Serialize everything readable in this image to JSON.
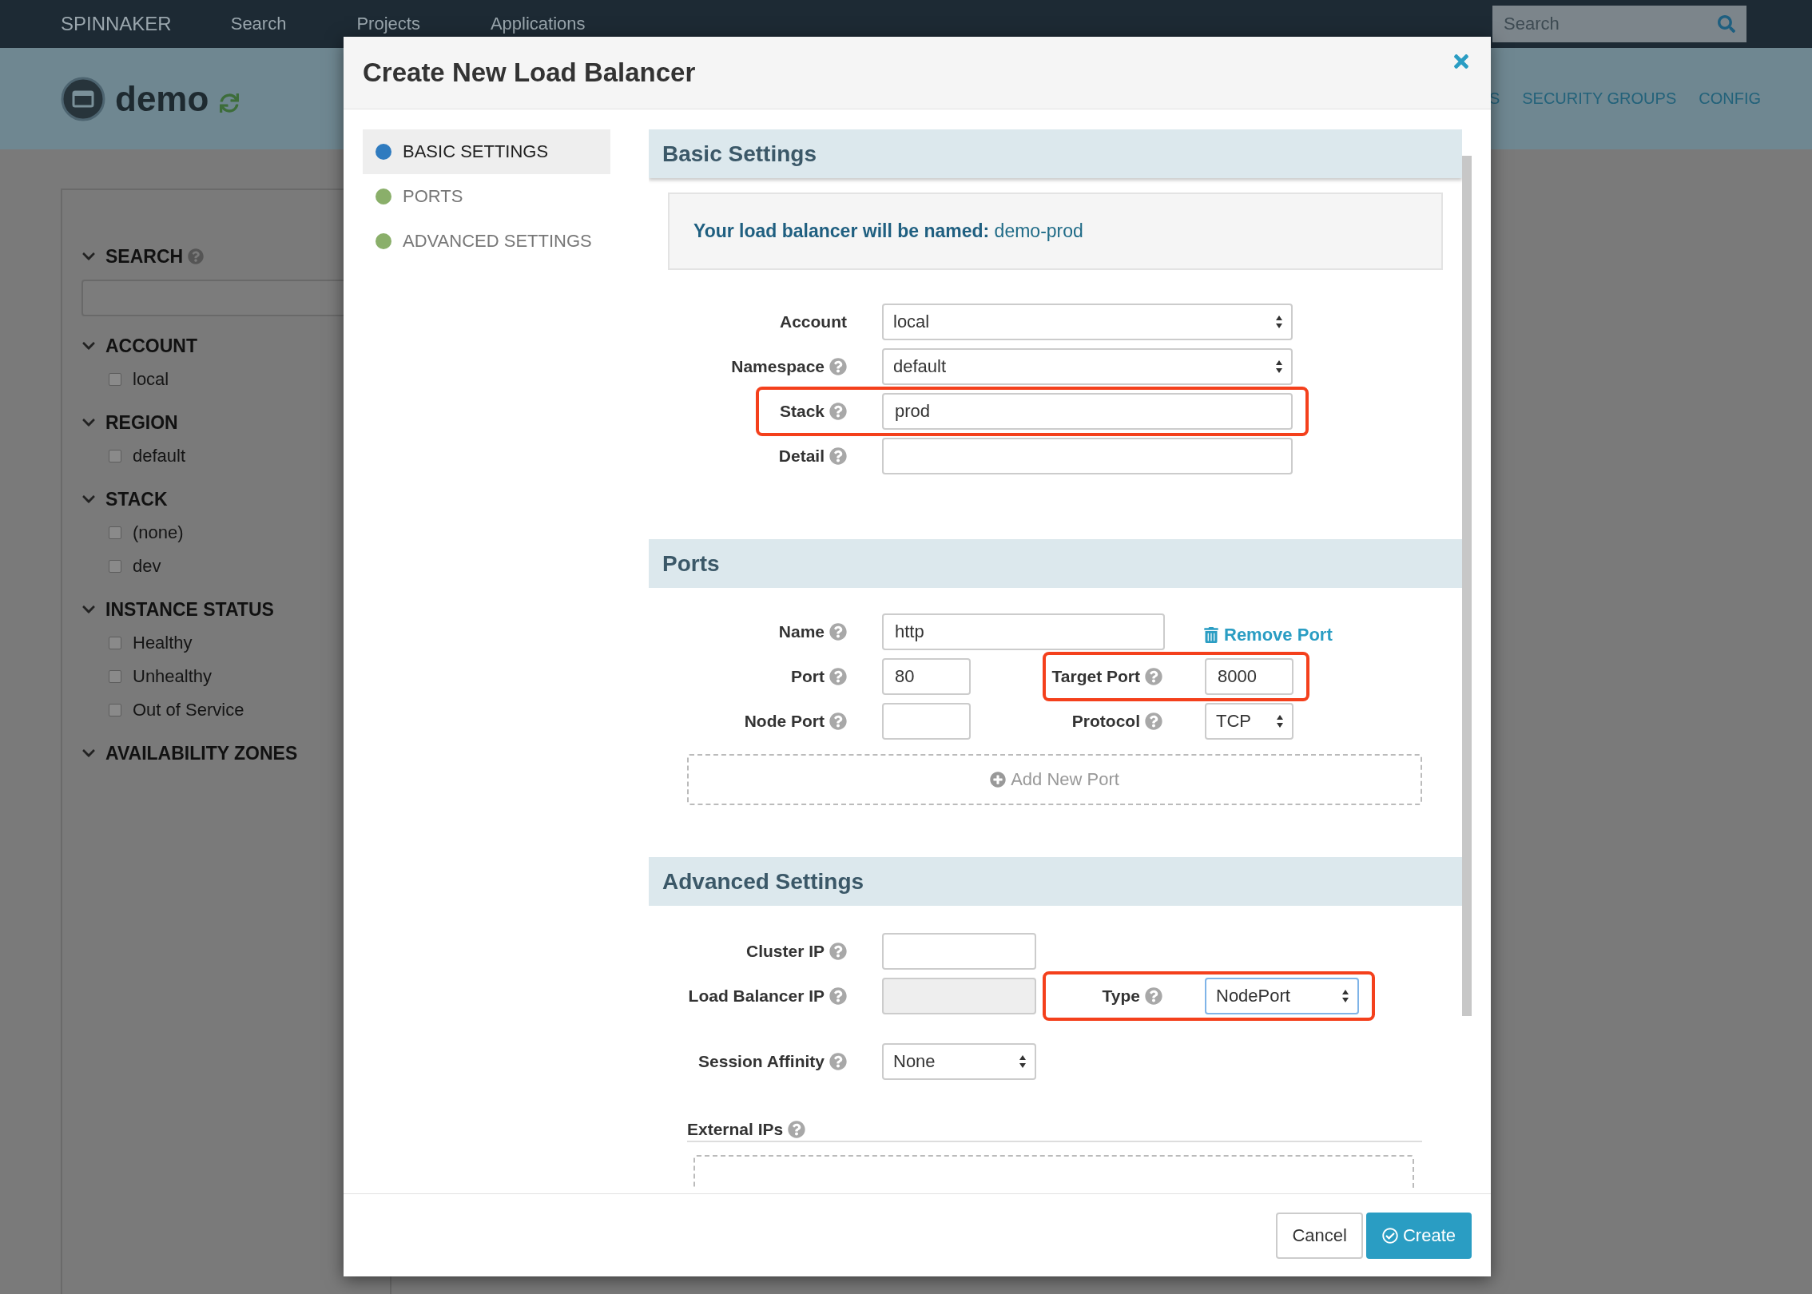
{
  "top_nav": {
    "brand": "SPINNAKER",
    "links": [
      "Search",
      "Projects",
      "Applications"
    ],
    "search": {
      "placeholder": "Search"
    }
  },
  "app_header": {
    "title": "demo",
    "tabs": [
      "S",
      "SECURITY GROUPS",
      "CONFIG"
    ]
  },
  "filters": [
    {
      "title": "SEARCH",
      "help": true,
      "kind": "search"
    },
    {
      "title": "ACCOUNT",
      "kind": "checkboxes",
      "options": [
        {
          "label": "local",
          "checked": false
        }
      ]
    },
    {
      "title": "REGION",
      "kind": "checkboxes",
      "options": [
        {
          "label": "default",
          "checked": false
        }
      ]
    },
    {
      "title": "STACK",
      "kind": "checkboxes",
      "options": [
        {
          "label": "(none)",
          "checked": false
        },
        {
          "label": "dev",
          "checked": false
        }
      ]
    },
    {
      "title": "INSTANCE STATUS",
      "kind": "checkboxes",
      "options": [
        {
          "label": "Healthy",
          "checked": false
        },
        {
          "label": "Unhealthy",
          "checked": false
        },
        {
          "label": "Out of Service",
          "checked": false
        }
      ]
    },
    {
      "title": "AVAILABILITY ZONES",
      "kind": "checkboxes"
    }
  ],
  "dialog": {
    "title": "Create New Load Balancer",
    "nav": [
      {
        "label": "BASIC SETTINGS",
        "selected": true,
        "color": "#2f7bbf"
      },
      {
        "label": "PORTS",
        "selected": false,
        "color": "#8aaf6a"
      },
      {
        "label": "ADVANCED SETTINGS",
        "selected": false,
        "color": "#8aaf6a"
      }
    ],
    "sections": [
      {
        "title": "Basic Settings",
        "notice": {
          "label": "Your load balancer will be named:",
          "value": "demo-prod"
        },
        "rows": [
          {
            "fields": [
              {
                "label": "Account",
                "kind": "select",
                "value": "local",
                "highlighted": false,
                "disabled": false,
                "focused": false
              }
            ]
          },
          {
            "fields": [
              {
                "label": "Namespace",
                "help": true,
                "kind": "select",
                "value": "default",
                "highlighted": false,
                "disabled": false,
                "focused": false
              }
            ]
          },
          {
            "fields": [
              {
                "label": "Stack",
                "help": true,
                "kind": "text",
                "value": "prod",
                "highlighted": true,
                "disabled": false,
                "focused": false
              }
            ]
          },
          {
            "fields": [
              {
                "label": "Detail",
                "help": true,
                "kind": "text",
                "highlighted": false,
                "disabled": false,
                "focused": false
              }
            ]
          }
        ]
      },
      {
        "title": "Ports",
        "rows": [
          {
            "fields": [
              {
                "label": "Name",
                "help": true,
                "kind": "text",
                "value": "http",
                "highlighted": false,
                "disabled": false,
                "focused": false
              }
            ],
            "action": {
              "label": "Remove Port"
            }
          },
          {
            "fields": [
              {
                "label": "Port",
                "help": true,
                "kind": "text",
                "value": "80",
                "highlighted": false,
                "disabled": false,
                "focused": false
              },
              {
                "label": "Target Port",
                "help": true,
                "kind": "text",
                "value": "8000",
                "highlighted": true,
                "disabled": false,
                "focused": false
              }
            ]
          },
          {
            "fields": [
              {
                "label": "Node Port",
                "help": true,
                "kind": "text",
                "highlighted": false,
                "disabled": false,
                "focused": false
              },
              {
                "label": "Protocol",
                "help": true,
                "kind": "select",
                "value": "TCP",
                "highlighted": false,
                "disabled": false,
                "focused": false
              }
            ]
          }
        ],
        "add_button": {
          "label": "Add New Port"
        }
      },
      {
        "title": "Advanced Settings",
        "rows": [
          {
            "fields": [
              {
                "label": "Cluster IP",
                "help": true,
                "kind": "text",
                "highlighted": false,
                "disabled": false,
                "focused": false
              }
            ]
          },
          {
            "fields": [
              {
                "label": "Load Balancer IP",
                "help": true,
                "kind": "text",
                "highlighted": false,
                "disabled": true,
                "focused": false
              },
              {
                "label": "Type",
                "help": true,
                "kind": "select",
                "value": "NodePort",
                "highlighted": true,
                "disabled": false,
                "focused": true
              }
            ]
          },
          {
            "fields": [
              {
                "label": "Session Affinity",
                "help": true,
                "kind": "select",
                "value": "None",
                "highlighted": false,
                "disabled": false,
                "focused": false
              }
            ]
          }
        ],
        "subsections": [
          {
            "title": "External IPs",
            "help": true
          }
        ]
      }
    ],
    "buttons": [
      {
        "label": "Cancel",
        "kind": "secondary"
      },
      {
        "label": "Create",
        "kind": "primary"
      }
    ]
  }
}
